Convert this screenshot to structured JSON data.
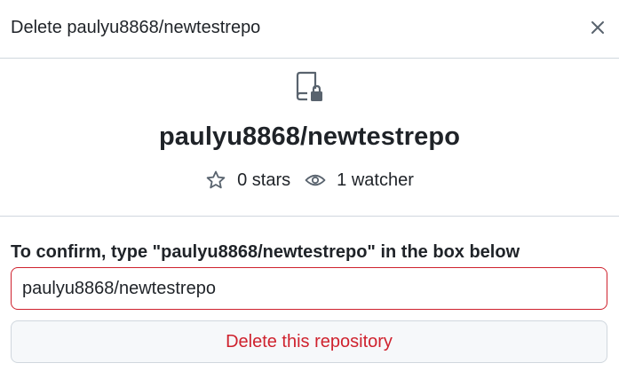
{
  "dialog": {
    "title": "Delete paulyu8868/newtestrepo",
    "close_icon": "x-icon"
  },
  "repo": {
    "icon": "repo-locked-icon",
    "full_name": "paulyu8868/newtestrepo",
    "stars_label": "0 stars",
    "stars_icon": "star-icon",
    "watchers_label": "1 watcher",
    "watchers_icon": "eye-icon"
  },
  "confirm": {
    "label": "To confirm, type \"paulyu8868/newtestrepo\" in the box below",
    "input_value": "paulyu8868/newtestrepo",
    "delete_button_label": "Delete this repository"
  },
  "colors": {
    "danger": "#cf222e",
    "border": "#d0d7de",
    "text": "#1f2328",
    "icon": "#59636e",
    "button_bg": "#f6f8fa"
  }
}
